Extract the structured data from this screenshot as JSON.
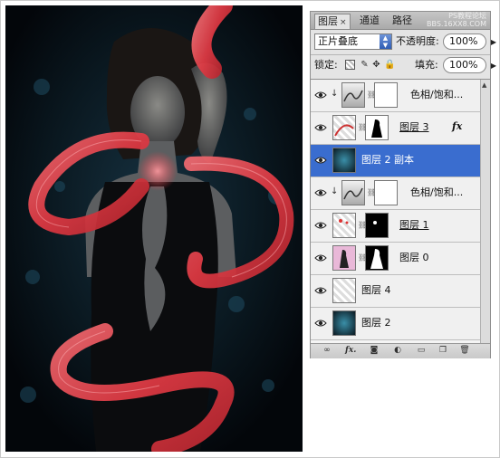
{
  "panel": {
    "tabs": [
      {
        "label": "图层",
        "close": "×",
        "active": true
      },
      {
        "label": "通道",
        "active": false
      },
      {
        "label": "路径",
        "active": false
      }
    ],
    "watermark_line1": "PS教程论坛",
    "watermark_line2": "BBS.16XX8.COM",
    "blend_mode": "正片叠底",
    "opacity_label": "不透明度:",
    "opacity_value": "100%",
    "lock_label": "锁定:",
    "fill_label": "填充:",
    "fill_value": "100%",
    "lock_icons": [
      "lock-transparency-icon",
      "lock-paint-icon",
      "lock-move-icon",
      "lock-all-icon"
    ]
  },
  "layers": [
    {
      "name": "色相/饱和...",
      "type": "adjustment",
      "clipped": true,
      "visible": true,
      "selected": false
    },
    {
      "name": "图层 3",
      "type": "masked",
      "clipped": false,
      "visible": true,
      "selected": false,
      "fx": "fx",
      "underline": true
    },
    {
      "name": "图层 2 副本",
      "type": "pixel",
      "clipped": false,
      "visible": true,
      "selected": true
    },
    {
      "name": "色相/饱和...",
      "type": "adjustment",
      "clipped": true,
      "visible": true,
      "selected": false
    },
    {
      "name": "图层 1",
      "type": "masked",
      "clipped": false,
      "visible": true,
      "selected": false,
      "underline": true
    },
    {
      "name": "图层 0",
      "type": "masked",
      "clipped": false,
      "visible": true,
      "selected": false
    },
    {
      "name": "图层 4",
      "type": "pixel",
      "clipped": false,
      "visible": true,
      "selected": false
    },
    {
      "name": "图层 2",
      "type": "pixel",
      "clipped": false,
      "visible": true,
      "selected": false
    }
  ],
  "bottom_icons": [
    "link-layers-icon",
    "fx-icon",
    "add-mask-icon",
    "adjustment-layer-icon",
    "new-group-icon",
    "new-layer-icon",
    "trash-icon"
  ],
  "colors": {
    "selection": "#3a6dcf",
    "ribbon": "#e8424a",
    "canvas_bg": "#05080c"
  }
}
